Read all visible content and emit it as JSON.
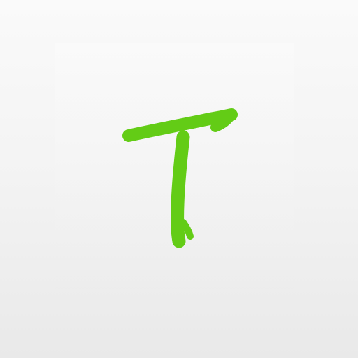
{
  "icon": {
    "name": "T",
    "background_top_color": "#fafafa",
    "background_bottom_color": "#e9e9e9",
    "letter_color": "#63cc16"
  }
}
